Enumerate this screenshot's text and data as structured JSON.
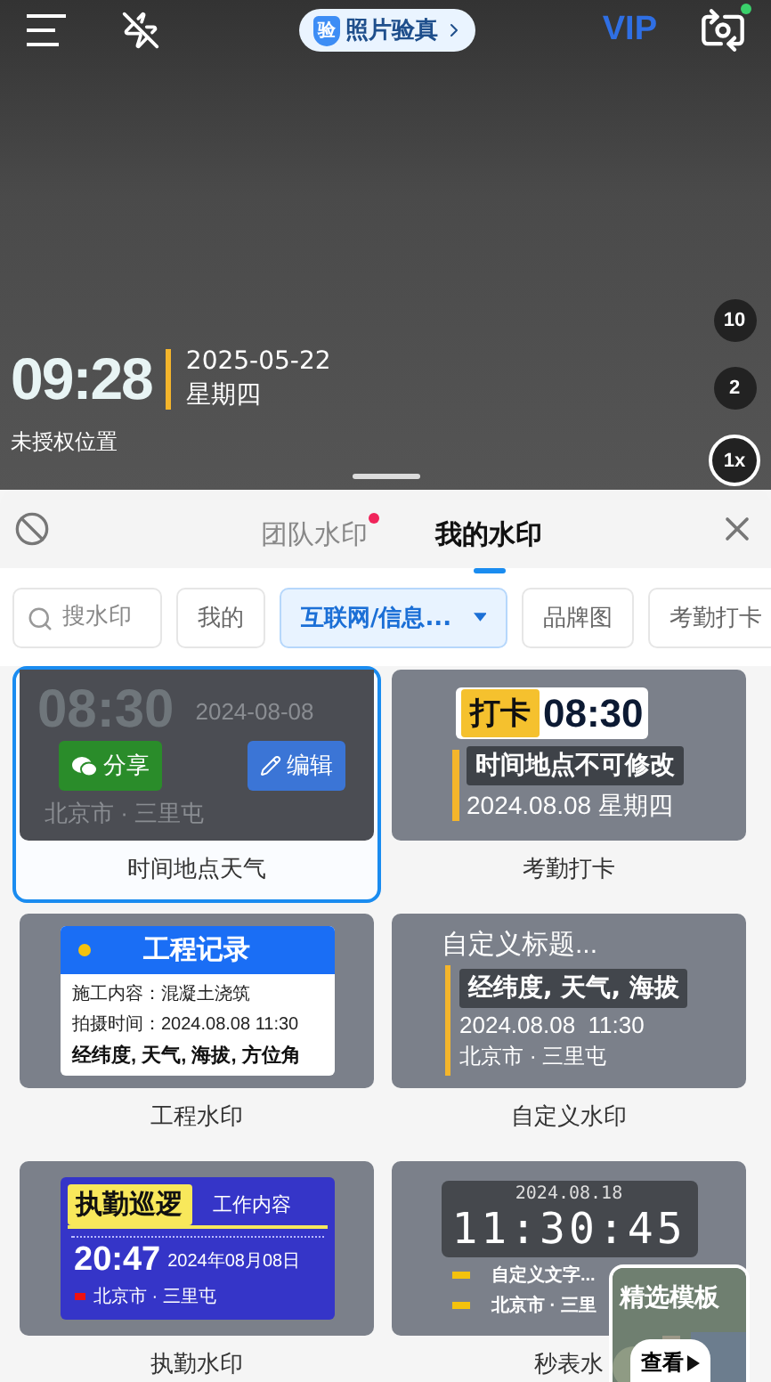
{
  "camera": {
    "verify": {
      "icon_text": "验",
      "label": "照片验真"
    },
    "vip": "VIP",
    "watermark": {
      "time": "09:28",
      "date": "2025-05-22",
      "weekday": "星期四",
      "location": "未授权位置"
    },
    "zoom_levels": [
      {
        "label": "10",
        "selected": false
      },
      {
        "label": "2",
        "selected": false
      },
      {
        "label": "1x",
        "selected": true
      }
    ]
  },
  "sheet": {
    "tabs": [
      {
        "label": "团队水印",
        "selected": false,
        "unread": true
      },
      {
        "label": "我的水印",
        "selected": true,
        "unread": false
      }
    ],
    "filters": [
      {
        "kind": "search",
        "placeholder": "搜水印",
        "selected": false
      },
      {
        "kind": "chip",
        "label": "我的",
        "selected": false
      },
      {
        "kind": "dropdown",
        "label": "互联网/信息...",
        "selected": true
      },
      {
        "kind": "chip",
        "label": "品牌图",
        "selected": false
      },
      {
        "kind": "chip",
        "label": "考勤打卡",
        "selected": false
      }
    ],
    "templates": [
      {
        "kind": "weather",
        "label": "时间地点天气",
        "selected": true,
        "time": "08:30",
        "date": "2024-08-08",
        "location": "北京市 · 三里屯",
        "actions": [
          "分享",
          "编辑"
        ]
      },
      {
        "kind": "punch",
        "label": "考勤打卡",
        "selected": false,
        "badge": "打卡",
        "time": "08:30",
        "note": "时间地点不可修改",
        "date": "2024.08.08 星期四"
      },
      {
        "kind": "engineering",
        "label": "工程水印",
        "selected": false,
        "title": "工程记录",
        "lines": [
          "施工内容：混凝土浇筑",
          "拍摄时间：2024.08.08 11:30"
        ],
        "footer": "经纬度, 天气, 海拔, 方位角"
      },
      {
        "kind": "custom",
        "label": "自定义水印",
        "selected": false,
        "title": "自定义标题...",
        "highlight": "经纬度, 天气, 海拔",
        "date": "2024.08.08  11:30",
        "location": "北京市 · 三里屯"
      },
      {
        "kind": "patrol",
        "label": "执勤水印",
        "selected": false,
        "badge": "执勤巡逻",
        "subtitle": "工作内容",
        "time": "20:47",
        "date": "2024年08月08日",
        "location": "北京市 · 三里屯"
      },
      {
        "kind": "stopwatch",
        "label": "秒表水",
        "selected": false,
        "date": "2024.08.18",
        "time": "11:30:45",
        "lines": [
          "自定义文字...",
          "北京市 · 三里"
        ]
      }
    ],
    "promo": {
      "title": "精选模板",
      "button": "查看"
    }
  }
}
